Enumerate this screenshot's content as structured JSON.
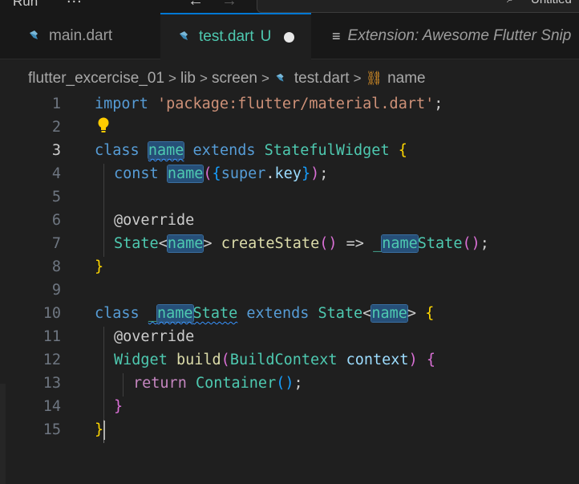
{
  "titlebar": {
    "menu_label": "Run",
    "more_label": "...",
    "back_icon": "arrow-left-icon",
    "forward_icon": "arrow-right-icon",
    "search_text": "Untitled"
  },
  "tabs": [
    {
      "label": "main.dart",
      "icon": "dart-file-icon",
      "active": false
    },
    {
      "label": "test.dart",
      "status": "U",
      "icon": "dart-file-icon",
      "active": true,
      "modified": true
    },
    {
      "label": "Extension: Awesome Flutter Snip",
      "icon": "preview-icon",
      "active": false
    }
  ],
  "breadcrumb": {
    "items": [
      "flutter_excercise_01",
      "lib",
      "screen",
      "test.dart",
      "name"
    ]
  },
  "editor": {
    "current_line": 3,
    "line_numbers": [
      "1",
      "2",
      "3",
      "4",
      "5",
      "6",
      "7",
      "8",
      "9",
      "10",
      "11",
      "12",
      "13",
      "14",
      "15"
    ],
    "lines": {
      "l1": {
        "kw": "import",
        "str": "'package:flutter/material.dart'",
        "end": ";"
      },
      "l3": {
        "kw": "class",
        "name": "name",
        "kw2": "extends",
        "type": "StatefulWidget",
        "brace": "{"
      },
      "l4": {
        "kw": "const",
        "name": "name",
        "p1": "(",
        "b1": "{",
        "super": "super",
        "dot": ".",
        "key": "key",
        "b2": "}",
        "p2": ")",
        "end": ";"
      },
      "l6": {
        "anno": "@override"
      },
      "l7": {
        "type": "State",
        "lt": "<",
        "name": "name",
        "gt": ">",
        "fn": "createState",
        "parens": "()",
        "arrow": "=>",
        "prefix": "_",
        "name2": "name",
        "suffix": "State",
        "parens2": "()",
        "end": ";"
      },
      "l8": {
        "brace": "}"
      },
      "l10": {
        "kw": "class",
        "prefix": "_",
        "name": "name",
        "suffix": "State",
        "kw2": "extends",
        "type": "State",
        "lt": "<",
        "name2": "name",
        "gt": ">",
        "brace": "{"
      },
      "l11": {
        "anno": "@override"
      },
      "l12": {
        "type": "Widget",
        "fn": "build",
        "p1": "(",
        "type2": "BuildContext",
        "param": "context",
        "p2": ")",
        "brace": "{"
      },
      "l13": {
        "kw": "return",
        "type": "Container",
        "parens": "()",
        "end": ";"
      },
      "l14": {
        "brace": "}"
      },
      "l15": {
        "brace": "}"
      }
    }
  }
}
